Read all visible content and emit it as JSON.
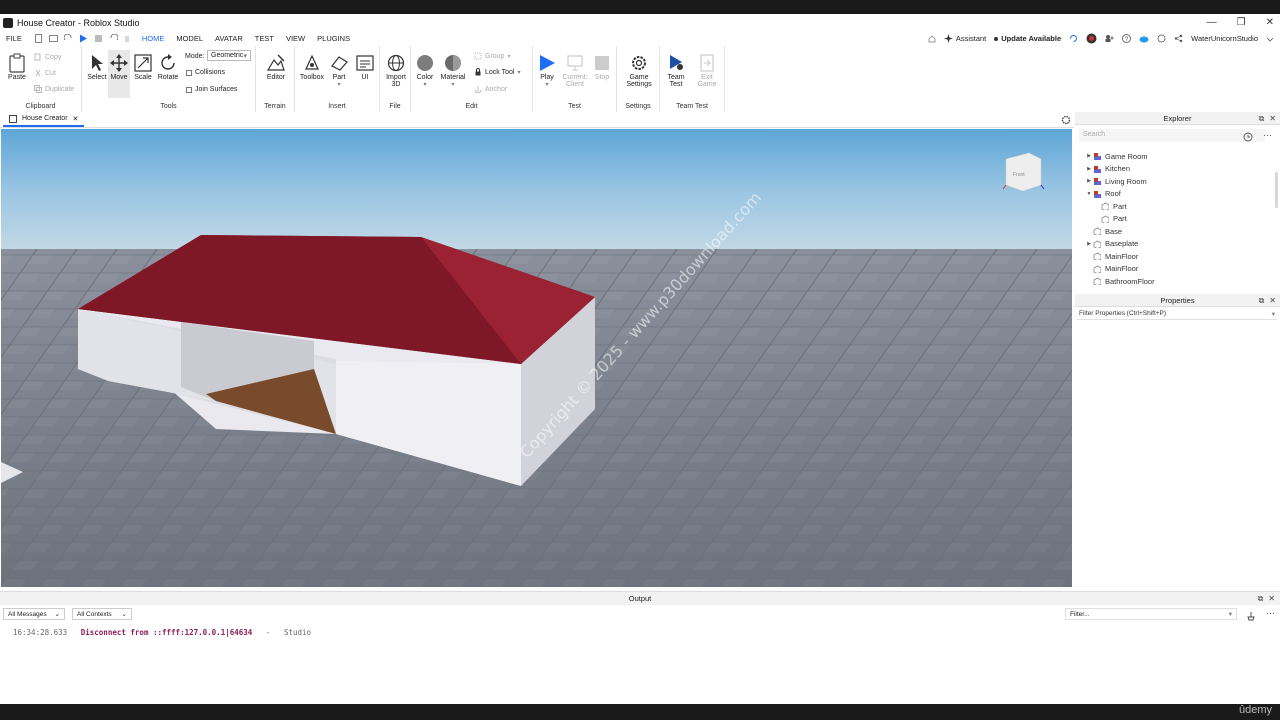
{
  "window": {
    "title": "House Creator - Roblox Studio",
    "controls": [
      "—",
      "❐",
      "✕"
    ]
  },
  "menubar": {
    "items": [
      "FILE",
      "HOME",
      "MODEL",
      "AVATAR",
      "TEST",
      "VIEW",
      "PLUGINS"
    ],
    "active": "HOME",
    "assistant": "Assistant",
    "update": "Update Available",
    "user": "WaterUnicornStudio"
  },
  "ribbon": {
    "clipboard": {
      "paste": "Paste",
      "copy": "Copy",
      "cut": "Cut",
      "duplicate": "Duplicate",
      "label": "Clipboard"
    },
    "tools": {
      "select": "Select",
      "move": "Move",
      "scale": "Scale",
      "rotate": "Rotate",
      "mode_label": "Mode:",
      "mode_value": "Geometric",
      "collisions": "Collisions",
      "join_surfaces": "Join Surfaces",
      "label": "Tools"
    },
    "terrain": {
      "editor": "Editor",
      "label": "Terrain"
    },
    "insert": {
      "toolbox": "Toolbox",
      "part": "Part",
      "ui": "UI",
      "label": "Insert"
    },
    "file": {
      "import3d_line1": "Import",
      "import3d_line2": "3D",
      "label": "File"
    },
    "edit": {
      "color": "Color",
      "material": "Material",
      "group": "Group",
      "lock_tool": "Lock Tool",
      "anchor": "Anchor",
      "label": "Edit"
    },
    "test": {
      "play": "Play",
      "current_line1": "Current:",
      "current_line2": "Client",
      "stop": "Stop",
      "label": "Test"
    },
    "settings": {
      "game_line1": "Game",
      "game_line2": "Settings",
      "label": "Settings"
    },
    "team_test": {
      "team_line1": "Team",
      "team_line2": "Test",
      "exit_line1": "Exit",
      "exit_line2": "Game",
      "label": "Team Test"
    }
  },
  "doc_tab": {
    "label": "House Creator"
  },
  "viewport": {
    "watermark": "Copyright © 2025 - www.p30download.com",
    "view_cube_label": "Front"
  },
  "explorer": {
    "title": "Explorer",
    "search_placeholder": "Search",
    "items": [
      {
        "label": "Game Room",
        "expandable": true,
        "type": "model",
        "depth": 0
      },
      {
        "label": "Kitchen",
        "expandable": true,
        "type": "model",
        "depth": 0
      },
      {
        "label": "Living Room",
        "expandable": true,
        "type": "model",
        "depth": 0
      },
      {
        "label": "Roof",
        "expandable": true,
        "expanded": true,
        "type": "model",
        "depth": 0
      },
      {
        "label": "Part",
        "expandable": false,
        "type": "part",
        "depth": 1
      },
      {
        "label": "Part",
        "expandable": false,
        "type": "part",
        "depth": 1
      },
      {
        "label": "Base",
        "expandable": false,
        "type": "part",
        "depth": 0
      },
      {
        "label": "Baseplate",
        "expandable": true,
        "type": "part",
        "depth": 0
      },
      {
        "label": "MainFloor",
        "expandable": false,
        "type": "part",
        "depth": 0
      },
      {
        "label": "MainFloor",
        "expandable": false,
        "type": "part",
        "depth": 0
      },
      {
        "label": "BathroomFloor",
        "expandable": false,
        "type": "part",
        "depth": 0
      }
    ]
  },
  "properties": {
    "title": "Properties",
    "filter_placeholder": "Filter Properties (Ctrl+Shift+P)"
  },
  "output": {
    "title": "Output",
    "messages_filter": "All Messages",
    "contexts_filter": "All Contexts",
    "filter_placeholder": "Filter...",
    "log": {
      "timestamp": "16:34:28.633",
      "message": "Disconnect from ::ffff:127.0.0.1|64634",
      "separator": "-",
      "source": "Studio"
    }
  },
  "footer_brand": "ûdemy",
  "colors": {
    "accent": "#1d6ef5",
    "roof": "#8a1a2a",
    "model_icon": "#c0392b",
    "log_message": "#8b1e5a"
  }
}
